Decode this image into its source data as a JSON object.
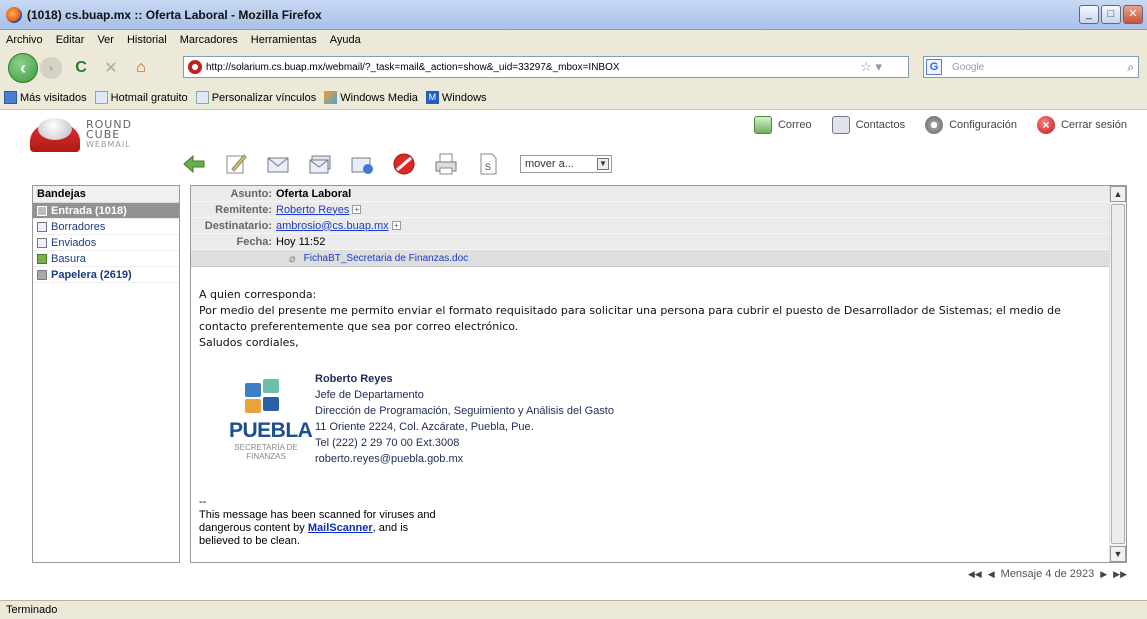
{
  "window": {
    "title": "(1018) cs.buap.mx :: Oferta Laboral - Mozilla Firefox"
  },
  "menu": [
    "Archivo",
    "Editar",
    "Ver",
    "Historial",
    "Marcadores",
    "Herramientas",
    "Ayuda"
  ],
  "nav": {
    "url": "http://solarium.cs.buap.mx/webmail/?_task=mail&_action=show&_uid=33297&_mbox=INBOX",
    "search_placeholder": "Google"
  },
  "bookmarks": [
    "Más visitados",
    "Hotmail gratuito",
    "Personalizar vínculos",
    "Windows Media",
    "Windows"
  ],
  "app": {
    "logo_line1": "ROUND",
    "logo_line2": "CUBE",
    "logo_line3": "WEBMAIL",
    "topnav": {
      "mail": "Correo",
      "contacts": "Contactos",
      "settings": "Configuración",
      "logout": "Cerrar sesión"
    },
    "moveto": "mover a..."
  },
  "folders": {
    "title": "Bandejas",
    "items": [
      {
        "label": "Entrada (1018)"
      },
      {
        "label": "Borradores"
      },
      {
        "label": "Enviados"
      },
      {
        "label": "Basura"
      },
      {
        "label": "Papelera (2619)"
      }
    ]
  },
  "message": {
    "subject_label": "Asunto:",
    "subject": "Oferta Laboral",
    "from_label": "Remitente:",
    "from": "Roberto Reyes",
    "to_label": "Destinatario:",
    "to": "ambrosio@cs.buap.mx",
    "date_label": "Fecha:",
    "date": "Hoy 11:52",
    "attachment": "FichaBT_Secretaria de Finanzas.doc",
    "body": {
      "greeting": "A quien corresponda:",
      "para1": " Por medio del presente me permito enviar el formato requisitado para solicitar una persona para cubrir el puesto de Desarrollador de Sistemas; el medio de",
      "para2": "contacto preferentemente que sea por correo electrónico.",
      "closing": "Saludos cordiales,"
    },
    "signature": {
      "name": "Roberto Reyes",
      "title": "Jefe de Departamento",
      "department": "Dirección de Programación, Seguimiento y Análisis del Gasto",
      "address": "11 Oriente 2224, Col. Azcárate, Puebla, Pue.",
      "phone": "Tel (222) 2 29 70 00 Ext.3008",
      "email": "roberto.reyes@puebla.gob.mx",
      "logo_word": "PUEBLA",
      "logo_sub1": "SECRETARÍA DE",
      "logo_sub2": "FINANZAS"
    },
    "scanner": {
      "dashes": "--",
      "line1": "This message has been scanned for viruses and",
      "line2_pre": "dangerous content by ",
      "line2_link": "MailScanner",
      "line2_post": ", and is",
      "line3": "believed to be clean."
    }
  },
  "pager": {
    "text": "Mensaje 4 de 2923"
  },
  "status": {
    "text": "Terminado"
  },
  "colors": {
    "selected_folder": "#929292",
    "link": "#1c3bcc",
    "header_bg": "#ebebeb"
  }
}
